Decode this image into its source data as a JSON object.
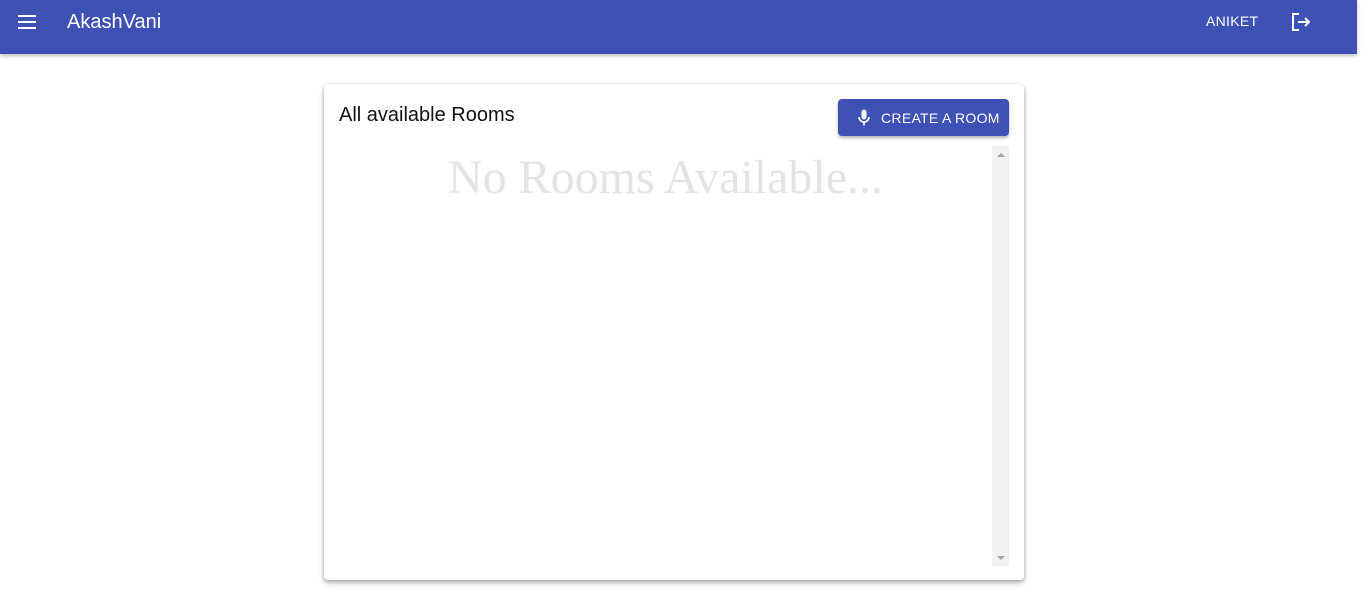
{
  "appbar": {
    "title": "AkashVani",
    "user_label": "ANIKET",
    "menu_icon": "menu-icon",
    "logout_icon": "logout-icon",
    "color": "#3f51b5"
  },
  "rooms_card": {
    "title": "All available Rooms",
    "create_button_label": "CREATE A ROOM",
    "create_button_icon": "mic-icon",
    "empty_message": "No Rooms Available..."
  }
}
